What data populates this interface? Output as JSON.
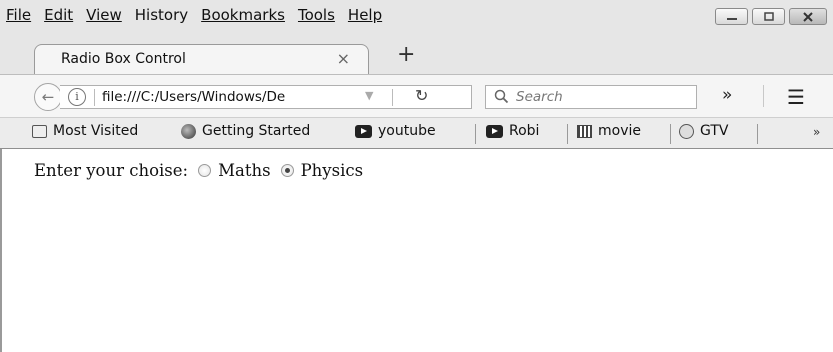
{
  "menu": {
    "items": [
      {
        "label": "File"
      },
      {
        "label": "Edit"
      },
      {
        "label": "View"
      },
      {
        "label": "History"
      },
      {
        "label": "Bookmarks"
      },
      {
        "label": "Tools"
      },
      {
        "label": "Help"
      }
    ]
  },
  "tab": {
    "title": "Radio Box Control",
    "close_icon": "×",
    "new_tab_icon": "+"
  },
  "navbar": {
    "url": "file:///C:/Users/Windows/De",
    "search_placeholder": "Search",
    "overflow_icon": "»",
    "menu_icon": "☰",
    "reload_icon": "↻",
    "back_icon": "←",
    "info_icon": "i"
  },
  "bookmarks": {
    "items": [
      {
        "label": "Most Visited",
        "icon": "most-visited-icon"
      },
      {
        "label": "Getting Started",
        "icon": "firefox-icon"
      },
      {
        "label": "youtube",
        "icon": "youtube-icon"
      },
      {
        "label": "Robi",
        "icon": "youtube-icon"
      },
      {
        "label": "movie",
        "icon": "movie-icon"
      },
      {
        "label": "GTV",
        "icon": "globe-icon"
      }
    ],
    "more_icon": "»"
  },
  "page": {
    "prompt": "Enter your choise:",
    "options": [
      {
        "label": "Maths",
        "checked": false
      },
      {
        "label": "Physics",
        "checked": true
      }
    ]
  }
}
